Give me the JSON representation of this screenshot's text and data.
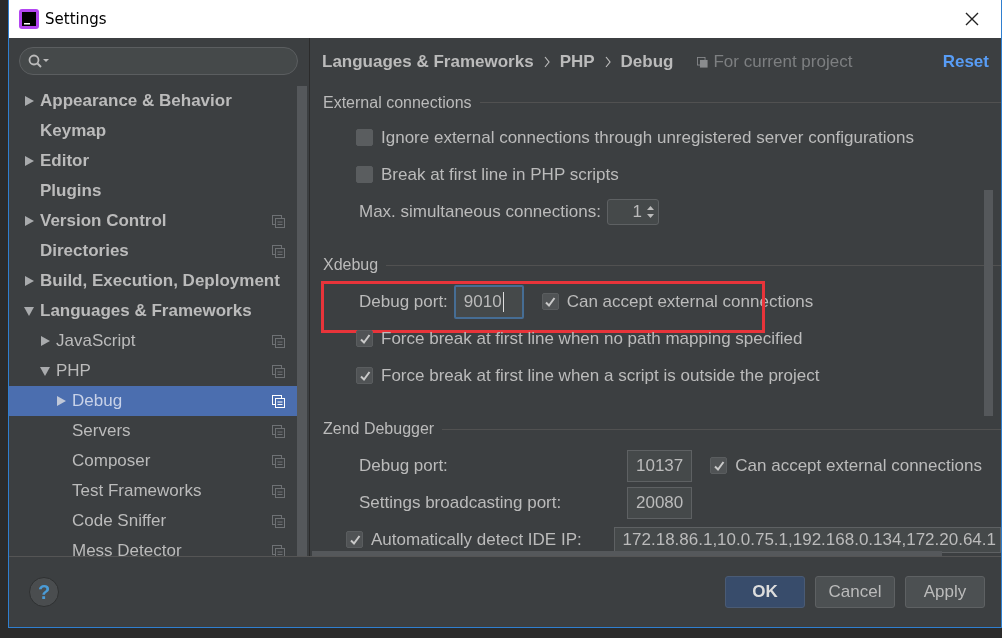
{
  "window": {
    "title": "Settings"
  },
  "tree": [
    {
      "label": "Appearance & Behavior",
      "expanded": false,
      "selected": false,
      "project_level": false
    },
    {
      "label": "Keymap",
      "selected": false,
      "project_level": false
    },
    {
      "label": "Editor",
      "expanded": false,
      "selected": false,
      "project_level": false
    },
    {
      "label": "Plugins",
      "selected": false,
      "project_level": false
    },
    {
      "label": "Version Control",
      "expanded": false,
      "selected": false,
      "project_level": true
    },
    {
      "label": "Directories",
      "selected": false,
      "project_level": true
    },
    {
      "label": "Build, Execution, Deployment",
      "expanded": false,
      "selected": false,
      "project_level": false
    },
    {
      "label": "Languages & Frameworks",
      "expanded": true,
      "selected": false,
      "project_level": false,
      "children": [
        {
          "label": "JavaScript",
          "expanded": false,
          "selected": false,
          "project_level": true
        },
        {
          "label": "PHP",
          "expanded": true,
          "selected": false,
          "project_level": true,
          "children": [
            {
              "label": "Debug",
              "expanded": false,
              "selected": true,
              "project_level": true
            },
            {
              "label": "Servers",
              "selected": false,
              "project_level": true
            },
            {
              "label": "Composer",
              "selected": false,
              "project_level": true
            },
            {
              "label": "Test Frameworks",
              "selected": false,
              "project_level": true
            },
            {
              "label": "Code Sniffer",
              "selected": false,
              "project_level": true
            },
            {
              "label": "Mess Detector",
              "selected": false,
              "project_level": true
            }
          ]
        }
      ]
    }
  ],
  "breadcrumb": [
    "Languages & Frameworks",
    "PHP",
    "Debug"
  ],
  "scope_note": "For current project",
  "reset_link": "Reset",
  "sections": [
    {
      "title": "External connections",
      "kind": "list",
      "rows": [
        {
          "kind": "checkbox",
          "label": "Ignore external connections through unregistered server configurations",
          "checked": false
        },
        {
          "kind": "checkbox",
          "label": "Break at first line in PHP scripts",
          "checked": false
        },
        {
          "kind": "spinner",
          "label": "Max. simultaneous connections:",
          "value": "1"
        }
      ]
    },
    {
      "title": "Xdebug",
      "kind": "list",
      "rows": [
        {
          "kind": "port",
          "label": "Debug port:",
          "value": "9010",
          "focused": true,
          "highlighted": true,
          "checkbox": {
            "label": "Can accept external connections",
            "checked": true
          }
        },
        {
          "kind": "checkbox",
          "label": "Force break at first line when no path mapping specified",
          "checked": true
        },
        {
          "kind": "checkbox",
          "label": "Force break at first line when a script is outside the project",
          "checked": true
        }
      ]
    },
    {
      "title": "Zend Debugger",
      "kind": "form",
      "rows": [
        {
          "kind": "port",
          "label": "Debug port:",
          "value": "10137",
          "focused": false,
          "highlighted": false,
          "checkbox": {
            "label": "Can accept external connections",
            "checked": true
          }
        },
        {
          "kind": "port",
          "label": "Settings broadcasting port:",
          "value": "20080",
          "focused": false,
          "highlighted": false
        },
        {
          "kind": "checked_field",
          "label": "Automatically detect IDE IP:",
          "checked": true,
          "value": "172.18.86.1,10.0.75.1,192.168.0.134,172.20.64.1"
        }
      ]
    }
  ],
  "help_button": "?",
  "buttons": [
    {
      "label": "OK",
      "default": true
    },
    {
      "label": "Cancel",
      "default": false
    },
    {
      "label": "Apply",
      "default": false
    }
  ]
}
